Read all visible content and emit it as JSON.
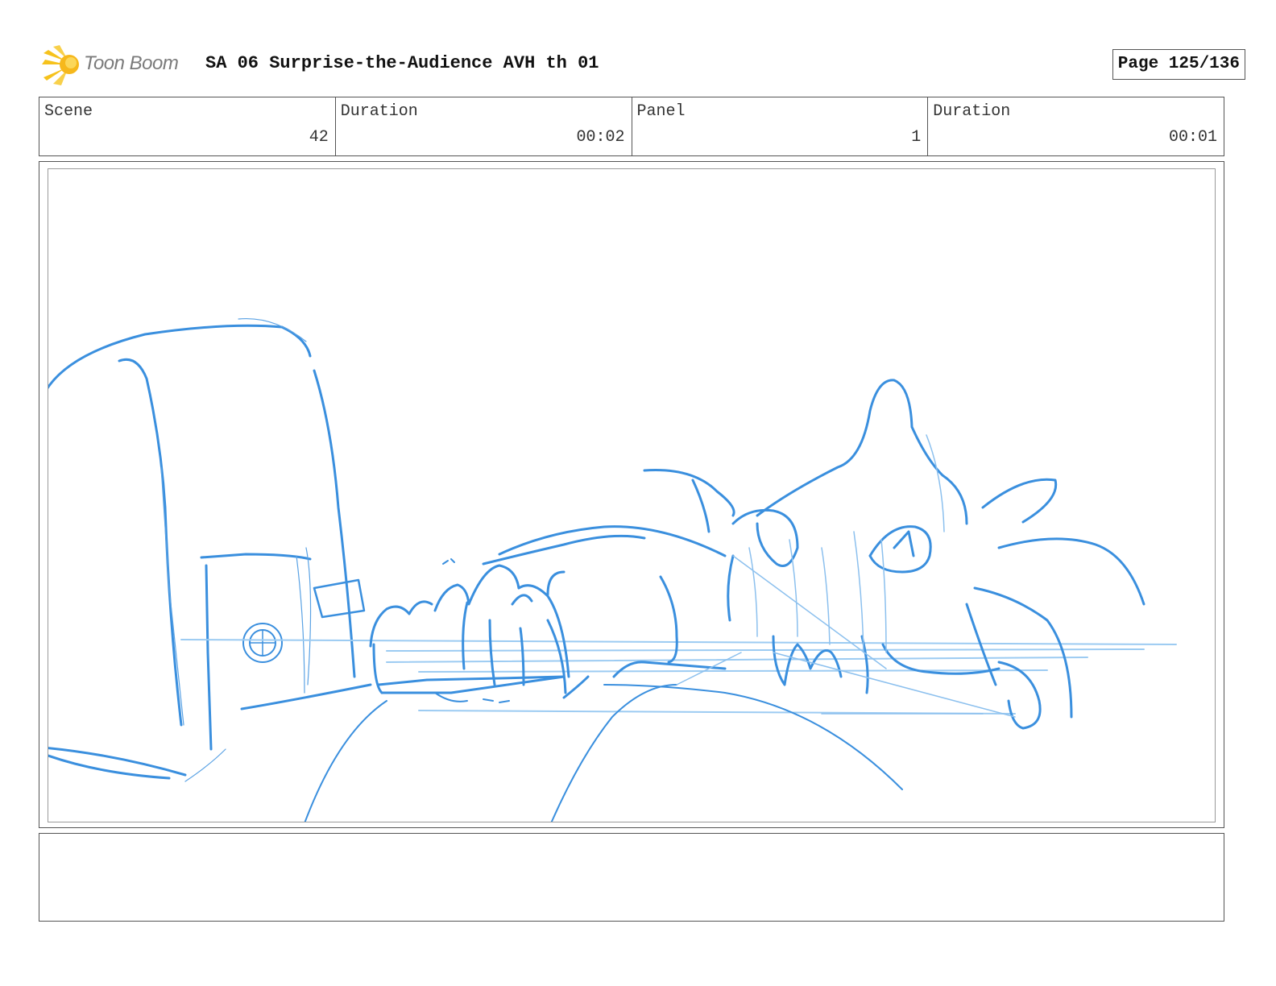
{
  "header": {
    "logo_text": "Toon Boom",
    "title": "SA 06 Surprise-the-Audience AVH th 01",
    "page_label": "Page 125/136"
  },
  "info": {
    "scene_label": "Scene",
    "scene_value": "42",
    "scene_duration_label": "Duration",
    "scene_duration_value": "00:02",
    "panel_label": "Panel",
    "panel_value": "1",
    "panel_duration_label": "Duration",
    "panel_duration_value": "00:01"
  },
  "notes": {
    "text": ""
  },
  "colors": {
    "sketch_blue": "#3a8fde",
    "sketch_light_blue": "#8cc0ee",
    "logo_yellow": "#f6c21c"
  }
}
